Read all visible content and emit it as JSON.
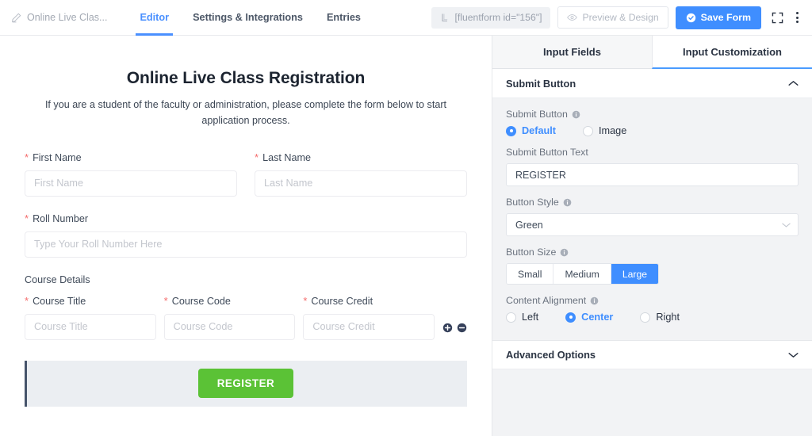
{
  "topbar": {
    "form_name": "Online Live Clas...",
    "pencil_icon": "pencil-icon",
    "tabs": [
      {
        "label": "Editor",
        "active": true
      },
      {
        "label": "Settings & Integrations",
        "active": false
      },
      {
        "label": "Entries",
        "active": false
      }
    ],
    "shortcode": "[fluentform id=\"156\"]",
    "shortcode_icon": "shortcode-icon",
    "preview_label": "Preview & Design",
    "preview_icon": "eye-icon",
    "save_label": "Save Form",
    "save_icon": "check-circle-icon",
    "expand_icon": "fullscreen-icon",
    "kebab_icon": "more-vertical-icon",
    "accent_blue": "#3f8eff"
  },
  "form": {
    "heading": "Online Live Class Registration",
    "subheading": "If you are a student of the faculty or administration, please complete the form below to start application process.",
    "required_mark": "*",
    "fields": [
      {
        "label": "First Name",
        "placeholder": "First Name",
        "required": true
      },
      {
        "label": "Last Name",
        "placeholder": "Last Name",
        "required": true
      },
      {
        "label": "Roll Number",
        "placeholder": "Type Your Roll Number Here",
        "required": true
      }
    ],
    "repeater": {
      "section_label": "Course Details",
      "columns": [
        {
          "label": "Course Title",
          "placeholder": "Course Title",
          "required": true
        },
        {
          "label": "Course Code",
          "placeholder": "Course Code",
          "required": true
        },
        {
          "label": "Course Credit",
          "placeholder": "Course Credit",
          "required": true
        }
      ],
      "add_icon": "plus-circle-icon",
      "remove_icon": "minus-circle-icon"
    },
    "submit": {
      "label": "REGISTER",
      "color": "#5bc236",
      "row_background": "#ebeef2",
      "selected_bar_color": "#46546b"
    }
  },
  "sidebar": {
    "tabs": [
      {
        "label": "Input Fields",
        "active": false
      },
      {
        "label": "Input Customization",
        "active": true
      }
    ],
    "panel": {
      "title": "Submit Button",
      "collapse_icon": "chevron-up-icon",
      "submit_button": {
        "label": "Submit Button",
        "info_icon": "info-icon",
        "options": [
          {
            "label": "Default",
            "selected": true
          },
          {
            "label": "Image",
            "selected": false
          }
        ]
      },
      "submit_button_text": {
        "label": "Submit Button Text",
        "value": "REGISTER"
      },
      "button_style": {
        "label": "Button Style",
        "info_icon": "info-icon",
        "value": "Green",
        "chevron_icon": "chevron-down-icon"
      },
      "button_size": {
        "label": "Button Size",
        "info_icon": "info-icon",
        "options": [
          {
            "label": "Small",
            "active": false
          },
          {
            "label": "Medium",
            "active": false
          },
          {
            "label": "Large",
            "active": true
          }
        ]
      },
      "content_alignment": {
        "label": "Content Alignment",
        "info_icon": "info-icon",
        "options": [
          {
            "label": "Left",
            "selected": false
          },
          {
            "label": "Center",
            "selected": true
          },
          {
            "label": "Right",
            "selected": false
          }
        ]
      }
    },
    "advanced": {
      "title": "Advanced Options",
      "expand_icon": "chevron-down-icon"
    }
  }
}
